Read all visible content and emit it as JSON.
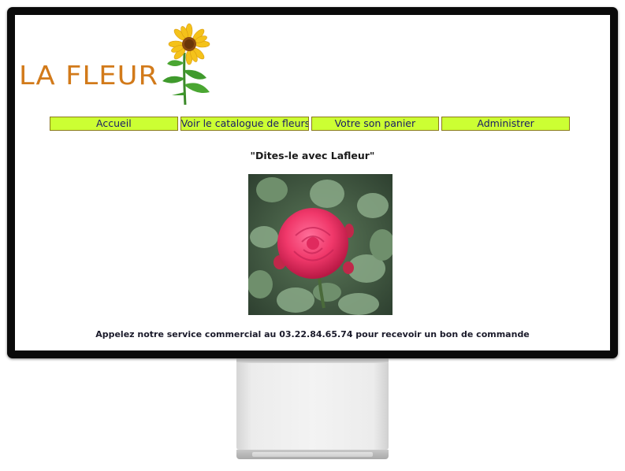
{
  "logo": {
    "text": "LA FLEUR",
    "color": "#d27a1a"
  },
  "nav": {
    "items": [
      {
        "label": "Accueil"
      },
      {
        "label": "Voir le catalogue de fleurs"
      },
      {
        "label": "Votre son panier"
      },
      {
        "label": "Administrer"
      }
    ],
    "background": "#ccff33"
  },
  "tagline": "\"Dites-le avec Lafleur\"",
  "hero_image": {
    "subject": "pink-rose-photo"
  },
  "footer": {
    "text": "Appelez notre service commercial au 03.22.84.65.74 pour recevoir un bon de commande"
  }
}
